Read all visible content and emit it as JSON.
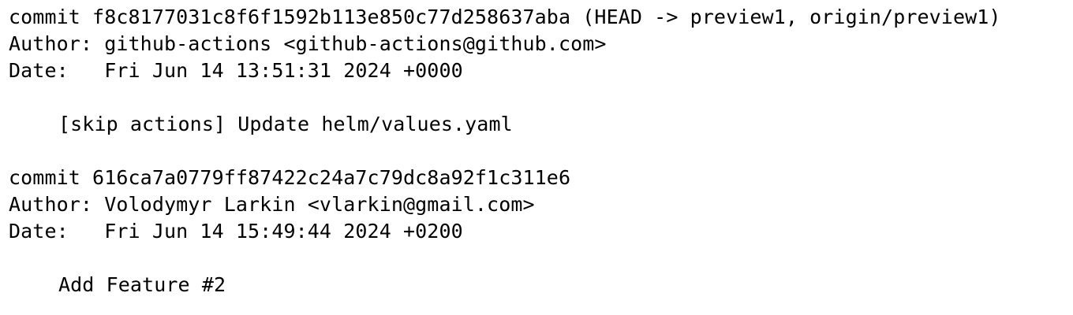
{
  "commits": [
    {
      "commit_line": "commit f8c8177031c8f6f1592b113e850c77d258637aba (HEAD -> preview1, origin/preview1)",
      "author_line": "Author: github-actions <github-actions@github.com>",
      "date_line": "Date:   Fri Jun 14 13:51:31 2024 +0000",
      "message": "[skip actions] Update helm/values.yaml"
    },
    {
      "commit_line": "commit 616ca7a0779ff87422c24a7c79dc8a92f1c311e6",
      "author_line": "Author: Volodymyr Larkin <vlarkin@gmail.com>",
      "date_line": "Date:   Fri Jun 14 15:49:44 2024 +0200",
      "message": "Add Feature #2"
    }
  ]
}
